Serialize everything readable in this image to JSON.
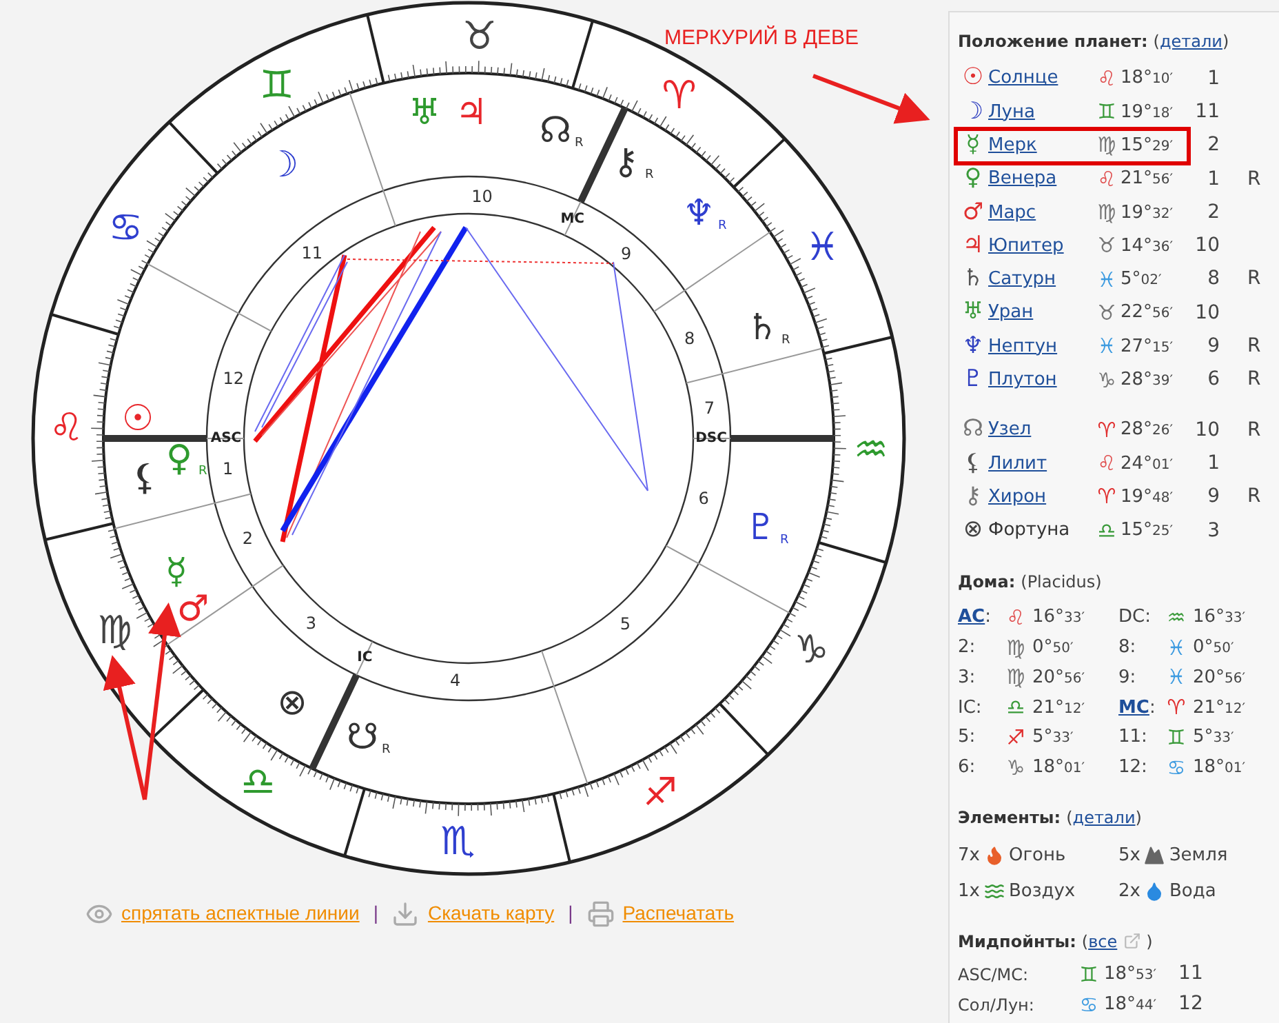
{
  "annotation": {
    "text": "МЕРКУРИЙ В ДЕВЕ"
  },
  "wheel": {
    "signs": [
      {
        "glyph": "♈",
        "color": "#e8262b"
      },
      {
        "glyph": "♉",
        "color": "#444444"
      },
      {
        "glyph": "♊",
        "color": "#2e9a2e"
      },
      {
        "glyph": "♋",
        "color": "#2f3fcf"
      },
      {
        "glyph": "♌",
        "color": "#e8262b"
      },
      {
        "glyph": "♍",
        "color": "#444444"
      },
      {
        "glyph": "♎",
        "color": "#2e9a2e"
      },
      {
        "glyph": "♏",
        "color": "#2f3fcf"
      },
      {
        "glyph": "♐",
        "color": "#e8262b"
      },
      {
        "glyph": "♑",
        "color": "#444444"
      },
      {
        "glyph": "♒",
        "color": "#2e9a2e"
      },
      {
        "glyph": "♓",
        "color": "#2f3fcf"
      }
    ],
    "house_numbers": [
      "1",
      "2",
      "3",
      "4",
      "5",
      "6",
      "7",
      "8",
      "9",
      "10",
      "11",
      "12"
    ],
    "angles": [
      "ASC",
      "IC",
      "DSC",
      "MC"
    ],
    "planets": [
      {
        "glyph": "♅",
        "color": "#2e9a2e"
      },
      {
        "glyph": "♃",
        "color": "#e8262b"
      },
      {
        "glyph": "☊",
        "color": "#333333",
        "retrograde": "R"
      },
      {
        "glyph": "☽",
        "color": "#2f3fcf"
      },
      {
        "glyph": "⚷",
        "color": "#333333",
        "retrograde": "R"
      },
      {
        "glyph": "♆",
        "color": "#2f3fcf",
        "retrograde": "R"
      },
      {
        "glyph": "♄",
        "color": "#333333",
        "retrograde": "R"
      },
      {
        "glyph": "☉",
        "color": "#e8262b"
      },
      {
        "glyph": "♀",
        "color": "#2e9a2e",
        "retrograde": "R"
      },
      {
        "glyph": "⚸",
        "color": "#333333"
      },
      {
        "glyph": "♇",
        "color": "#2f3fcf",
        "retrograde": "R"
      },
      {
        "glyph": "☿",
        "color": "#2e9a2e"
      },
      {
        "glyph": "♂",
        "color": "#e8262b"
      },
      {
        "glyph": "⊗",
        "color": "#333333"
      },
      {
        "glyph": "☋",
        "color": "#333333",
        "retrograde": "R"
      }
    ]
  },
  "chart_links": {
    "separator": "|",
    "items": [
      {
        "kind": "eye",
        "text": "спрятать аспектные линии"
      },
      {
        "kind": "download",
        "text": "Скачать карту"
      },
      {
        "kind": "print",
        "text": "Распечатать"
      }
    ]
  },
  "positions": {
    "title": "Положение планет:",
    "open": "(",
    "link": "детали",
    "close": ")",
    "planets": [
      {
        "symbol": {
          "glyph": "☉",
          "color": "#e03030"
        },
        "name": "Солнце",
        "link": true,
        "sign": {
          "glyph": "♌",
          "color": "#e05050"
        },
        "degrees": "18°",
        "minutes": "10′",
        "house": "1",
        "highlighted": false
      },
      {
        "symbol": {
          "glyph": "☽",
          "color": "#3040c0"
        },
        "name": "Луна",
        "link": true,
        "sign": {
          "glyph": "♊",
          "color": "#3a9a3a"
        },
        "degrees": "19°",
        "minutes": "18′",
        "house": "11",
        "highlighted": false
      },
      {
        "symbol": {
          "glyph": "☿",
          "color": "#3a9a3a"
        },
        "name": "Мерк",
        "link": true,
        "sign": {
          "glyph": "♍",
          "color": "#777777"
        },
        "degrees": "15°",
        "minutes": "29′",
        "house": "2",
        "highlighted": true
      },
      {
        "symbol": {
          "glyph": "♀",
          "color": "#3a9a3a"
        },
        "name": "Венера",
        "link": true,
        "sign": {
          "glyph": "♌",
          "color": "#e05050"
        },
        "degrees": "21°",
        "minutes": "56′",
        "house": "1",
        "retrograde": "R",
        "highlighted": false
      },
      {
        "symbol": {
          "glyph": "♂",
          "color": "#e03030"
        },
        "name": "Марс",
        "link": true,
        "sign": {
          "glyph": "♍",
          "color": "#777777"
        },
        "degrees": "19°",
        "minutes": "32′",
        "house": "2",
        "highlighted": false
      },
      {
        "symbol": {
          "glyph": "♃",
          "color": "#e03030"
        },
        "name": "Юпитер",
        "link": true,
        "sign": {
          "glyph": "♉",
          "color": "#777777"
        },
        "degrees": "14°",
        "minutes": "36′",
        "house": "10",
        "highlighted": false
      },
      {
        "symbol": {
          "glyph": "♄",
          "color": "#555555"
        },
        "name": "Сатурн",
        "link": true,
        "sign": {
          "glyph": "♓",
          "color": "#3d9be0"
        },
        "degrees": "5°",
        "minutes": "02′",
        "house": "8",
        "retrograde": "R",
        "highlighted": false
      },
      {
        "symbol": {
          "glyph": "♅",
          "color": "#3a9a3a"
        },
        "name": "Уран",
        "link": true,
        "sign": {
          "glyph": "♉",
          "color": "#777777"
        },
        "degrees": "22°",
        "minutes": "56′",
        "house": "10",
        "highlighted": false
      },
      {
        "symbol": {
          "glyph": "♆",
          "color": "#3040c0"
        },
        "name": "Нептун",
        "link": true,
        "sign": {
          "glyph": "♓",
          "color": "#3d9be0"
        },
        "degrees": "27°",
        "minutes": "15′",
        "house": "9",
        "retrograde": "R",
        "highlighted": false
      },
      {
        "symbol": {
          "glyph": "♇",
          "color": "#3040c0"
        },
        "name": "Плутон",
        "link": true,
        "sign": {
          "glyph": "♑",
          "color": "#777777"
        },
        "degrees": "28°",
        "minutes": "39′",
        "house": "6",
        "retrograde": "R",
        "highlighted": false
      }
    ],
    "points": [
      {
        "symbol": {
          "glyph": "☊",
          "color": "#777777"
        },
        "name": "Узел",
        "link": true,
        "sign": {
          "glyph": "♈",
          "color": "#e03030"
        },
        "degrees": "28°",
        "minutes": "26′",
        "house": "10",
        "retrograde": "R",
        "highlighted": false
      },
      {
        "symbol": {
          "glyph": "⚸",
          "color": "#555555"
        },
        "name": "Лилит",
        "link": true,
        "sign": {
          "glyph": "♌",
          "color": "#e05050"
        },
        "degrees": "24°",
        "minutes": "01′",
        "house": "1",
        "highlighted": false
      },
      {
        "symbol": {
          "glyph": "⚷",
          "color": "#777777"
        },
        "name": "Хирон",
        "link": true,
        "sign": {
          "glyph": "♈",
          "color": "#e03030"
        },
        "degrees": "19°",
        "minutes": "48′",
        "house": "9",
        "retrograde": "R",
        "highlighted": false
      },
      {
        "symbol": {
          "glyph": "⊗",
          "color": "#444444"
        },
        "name": "Фортуна",
        "link": false,
        "sign": {
          "glyph": "♎",
          "color": "#3a9a3a"
        },
        "degrees": "15°",
        "minutes": "25′",
        "house": "3",
        "highlighted": false
      }
    ]
  },
  "houses": {
    "title": "Дома:",
    "system": "(Placidus)",
    "items": [
      {
        "label": "AC",
        "sep": ":",
        "link": true,
        "sign": {
          "glyph": "♌",
          "color": "#e05050"
        },
        "degrees": "16°",
        "minutes": "33′"
      },
      {
        "label": "DC:",
        "link": false,
        "sign": {
          "glyph": "♒",
          "color": "#3a9a3a"
        },
        "degrees": "16°",
        "minutes": "33′"
      },
      {
        "label": "2:",
        "link": false,
        "sign": {
          "glyph": "♍",
          "color": "#777777"
        },
        "degrees": "0°",
        "minutes": "50′"
      },
      {
        "label": "8:",
        "link": false,
        "sign": {
          "glyph": "♓",
          "color": "#3d9be0"
        },
        "degrees": "0°",
        "minutes": "50′"
      },
      {
        "label": "3:",
        "link": false,
        "sign": {
          "glyph": "♍",
          "color": "#777777"
        },
        "degrees": "20°",
        "minutes": "56′"
      },
      {
        "label": "9:",
        "link": false,
        "sign": {
          "glyph": "♓",
          "color": "#3d9be0"
        },
        "degrees": "20°",
        "minutes": "56′"
      },
      {
        "label": "IC:",
        "link": false,
        "sign": {
          "glyph": "♎",
          "color": "#3a9a3a"
        },
        "degrees": "21°",
        "minutes": "12′"
      },
      {
        "label": "MC",
        "sep": ":",
        "link": true,
        "sign": {
          "glyph": "♈",
          "color": "#e03030"
        },
        "degrees": "21°",
        "minutes": "12′"
      },
      {
        "label": "5:",
        "link": false,
        "sign": {
          "glyph": "♐",
          "color": "#e03030"
        },
        "degrees": "5°",
        "minutes": "33′"
      },
      {
        "label": "11:",
        "link": false,
        "sign": {
          "glyph": "♊",
          "color": "#3a9a3a"
        },
        "degrees": "5°",
        "minutes": "33′"
      },
      {
        "label": "6:",
        "link": false,
        "sign": {
          "glyph": "♑",
          "color": "#777777"
        },
        "degrees": "18°",
        "minutes": "01′"
      },
      {
        "label": "12:",
        "link": false,
        "sign": {
          "glyph": "♋",
          "color": "#3d9be0"
        },
        "degrees": "18°",
        "minutes": "01′"
      }
    ]
  },
  "elements": {
    "title": "Элементы:",
    "open": "(",
    "link": "детали",
    "close": ")",
    "items": [
      {
        "kind": "fire",
        "count": "7x",
        "name": "Огонь"
      },
      {
        "kind": "earth",
        "count": "5x",
        "name": "Земля"
      },
      {
        "kind": "air",
        "count": "1x",
        "name": "Воздух"
      },
      {
        "kind": "water",
        "count": "2x",
        "name": "Вода"
      }
    ]
  },
  "midpoints": {
    "title": "Мидпойнты:",
    "open": "(",
    "link": "все",
    "close": ")",
    "items": [
      {
        "label": "ASC/MC:",
        "sign": {
          "glyph": "♊",
          "color": "#3a9a3a"
        },
        "degrees": "18°",
        "minutes": "53′",
        "house": "11"
      },
      {
        "label": "Сол/Лун:",
        "sign": {
          "glyph": "♋",
          "color": "#3d9be0"
        },
        "degrees": "18°",
        "minutes": "44′",
        "house": "12"
      }
    ]
  }
}
